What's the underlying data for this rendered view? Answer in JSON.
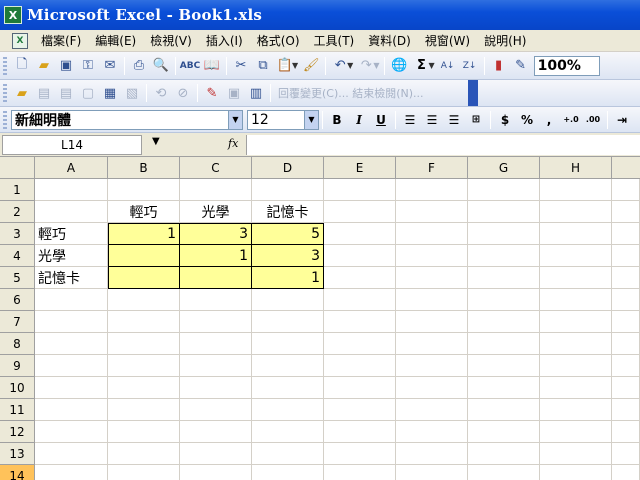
{
  "window": {
    "title": "Microsoft Excel - Book1.xls",
    "app_icon": "excel-icon"
  },
  "menu": {
    "items": [
      "檔案(F)",
      "編輯(E)",
      "檢視(V)",
      "插入(I)",
      "格式(O)",
      "工具(T)",
      "資料(D)",
      "視窗(W)",
      "說明(H)"
    ]
  },
  "toolbar": {
    "zoom": "100%"
  },
  "review_toolbar": {
    "reply_label": "回覆變更(C)... 結束檢閱(N)..."
  },
  "format_toolbar": {
    "font_name": "新細明體",
    "font_size": "12",
    "bold": "B",
    "italic": "I",
    "underline": "U",
    "currency": "$",
    "percent": "%",
    "comma": ","
  },
  "formula_bar": {
    "name_box": "L14",
    "fx_label": "fx",
    "value": ""
  },
  "sheet": {
    "columns": [
      "A",
      "B",
      "C",
      "D",
      "E",
      "F",
      "G",
      "H"
    ],
    "rows": [
      "1",
      "2",
      "3",
      "4",
      "5",
      "6",
      "7",
      "8",
      "9",
      "10",
      "11",
      "12",
      "13",
      "14"
    ],
    "active_row": "14",
    "cells": {
      "B2": "輕巧",
      "C2": "光學",
      "D2": "記憶卡",
      "A3": "輕巧",
      "B3": "1",
      "C3": "3",
      "D3": "5",
      "A4": "光學",
      "C4": "1",
      "D4": "3",
      "A5": "記憶卡",
      "D5": "1"
    }
  }
}
